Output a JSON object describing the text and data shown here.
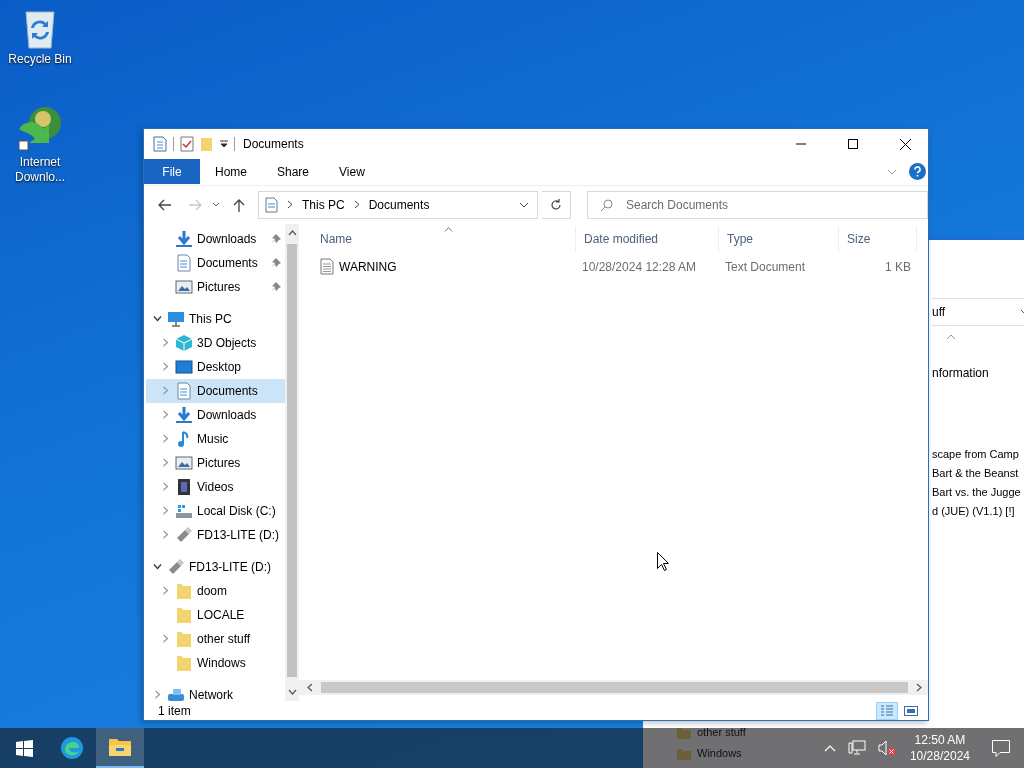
{
  "desktop_icons": [
    {
      "label": "Recycle Bin",
      "kind": "recycle"
    },
    {
      "label": "Internet Downlo...",
      "kind": "downloader"
    }
  ],
  "background_window": {
    "dropdown_text": "uff",
    "info_text": "nformation",
    "lines": [
      "scape from Camp",
      "Bart & the Beanst",
      "Bart vs. the Jugge",
      "d (JUE) (V1.1) [!]"
    ],
    "bottom_items": [
      "other stuff",
      "Windows"
    ]
  },
  "explorer": {
    "title": "Documents",
    "ribbon_tabs": [
      {
        "label": "File",
        "kind": "file"
      },
      {
        "label": "Home",
        "kind": "tab"
      },
      {
        "label": "Share",
        "kind": "tab"
      },
      {
        "label": "View",
        "kind": "tab"
      }
    ],
    "history_buttons": [
      {
        "kind": "back",
        "disabled": false
      },
      {
        "kind": "forward",
        "disabled": true
      }
    ],
    "breadcrumbs": [
      "This PC",
      "Documents"
    ],
    "search": {
      "placeholder": "Search Documents"
    },
    "nav": {
      "quick_access": [
        {
          "label": "Downloads",
          "kind": "download",
          "pinned": true,
          "selected": false
        },
        {
          "label": "Documents",
          "kind": "document",
          "pinned": true,
          "selected": false
        },
        {
          "label": "Pictures",
          "kind": "picture",
          "pinned": true,
          "selected": false
        }
      ],
      "tree": [
        {
          "label": "This PC",
          "kind": "pc",
          "expanded": true,
          "selected": false,
          "children": [
            {
              "label": "3D Objects",
              "kind": "cube",
              "expanded": false,
              "selected": false
            },
            {
              "label": "Desktop",
              "kind": "desktop",
              "expanded": false,
              "selected": false
            },
            {
              "label": "Documents",
              "kind": "document",
              "expanded": false,
              "selected": true
            },
            {
              "label": "Downloads",
              "kind": "download",
              "expanded": false,
              "selected": false
            },
            {
              "label": "Music",
              "kind": "music",
              "expanded": false,
              "selected": false
            },
            {
              "label": "Pictures",
              "kind": "picture",
              "expanded": false,
              "selected": false
            },
            {
              "label": "Videos",
              "kind": "video",
              "expanded": false,
              "selected": false
            },
            {
              "label": "Local Disk (C:)",
              "kind": "disk",
              "expanded": false,
              "selected": false
            },
            {
              "label": "FD13-LITE (D:)",
              "kind": "usb",
              "expanded": false,
              "selected": false
            }
          ]
        },
        {
          "label": "FD13-LITE (D:)",
          "kind": "usb",
          "expanded": true,
          "selected": false,
          "children": [
            {
              "label": "doom",
              "kind": "folder",
              "expanded": false,
              "selected": false
            },
            {
              "label": "LOCALE",
              "kind": "folder",
              "selected": false
            },
            {
              "label": "other stuff",
              "kind": "folder",
              "expanded": false,
              "selected": false
            },
            {
              "label": "Windows",
              "kind": "folder",
              "selected": false
            }
          ]
        },
        {
          "label": "Network",
          "kind": "network",
          "expanded": false,
          "selected": false
        }
      ]
    },
    "columns": [
      {
        "label": "Name",
        "sorted": true
      },
      {
        "label": "Date modified"
      },
      {
        "label": "Type"
      },
      {
        "label": "Size"
      }
    ],
    "files": [
      {
        "name": "WARNING",
        "date": "10/28/2024 12:28 AM",
        "type": "Text Document",
        "size": "1 KB",
        "selected": false
      }
    ],
    "status_bar": {
      "item_count": "1 item",
      "views": [
        {
          "kind": "details",
          "selected": true
        },
        {
          "kind": "large_icons",
          "selected": false
        }
      ]
    }
  },
  "taskbar": {
    "apps": [
      {
        "kind": "edge",
        "active": false
      },
      {
        "kind": "explorer",
        "active": true
      }
    ],
    "tray": {
      "volume_muted": true,
      "time": "12:50 AM",
      "date": "10/28/2024"
    }
  }
}
